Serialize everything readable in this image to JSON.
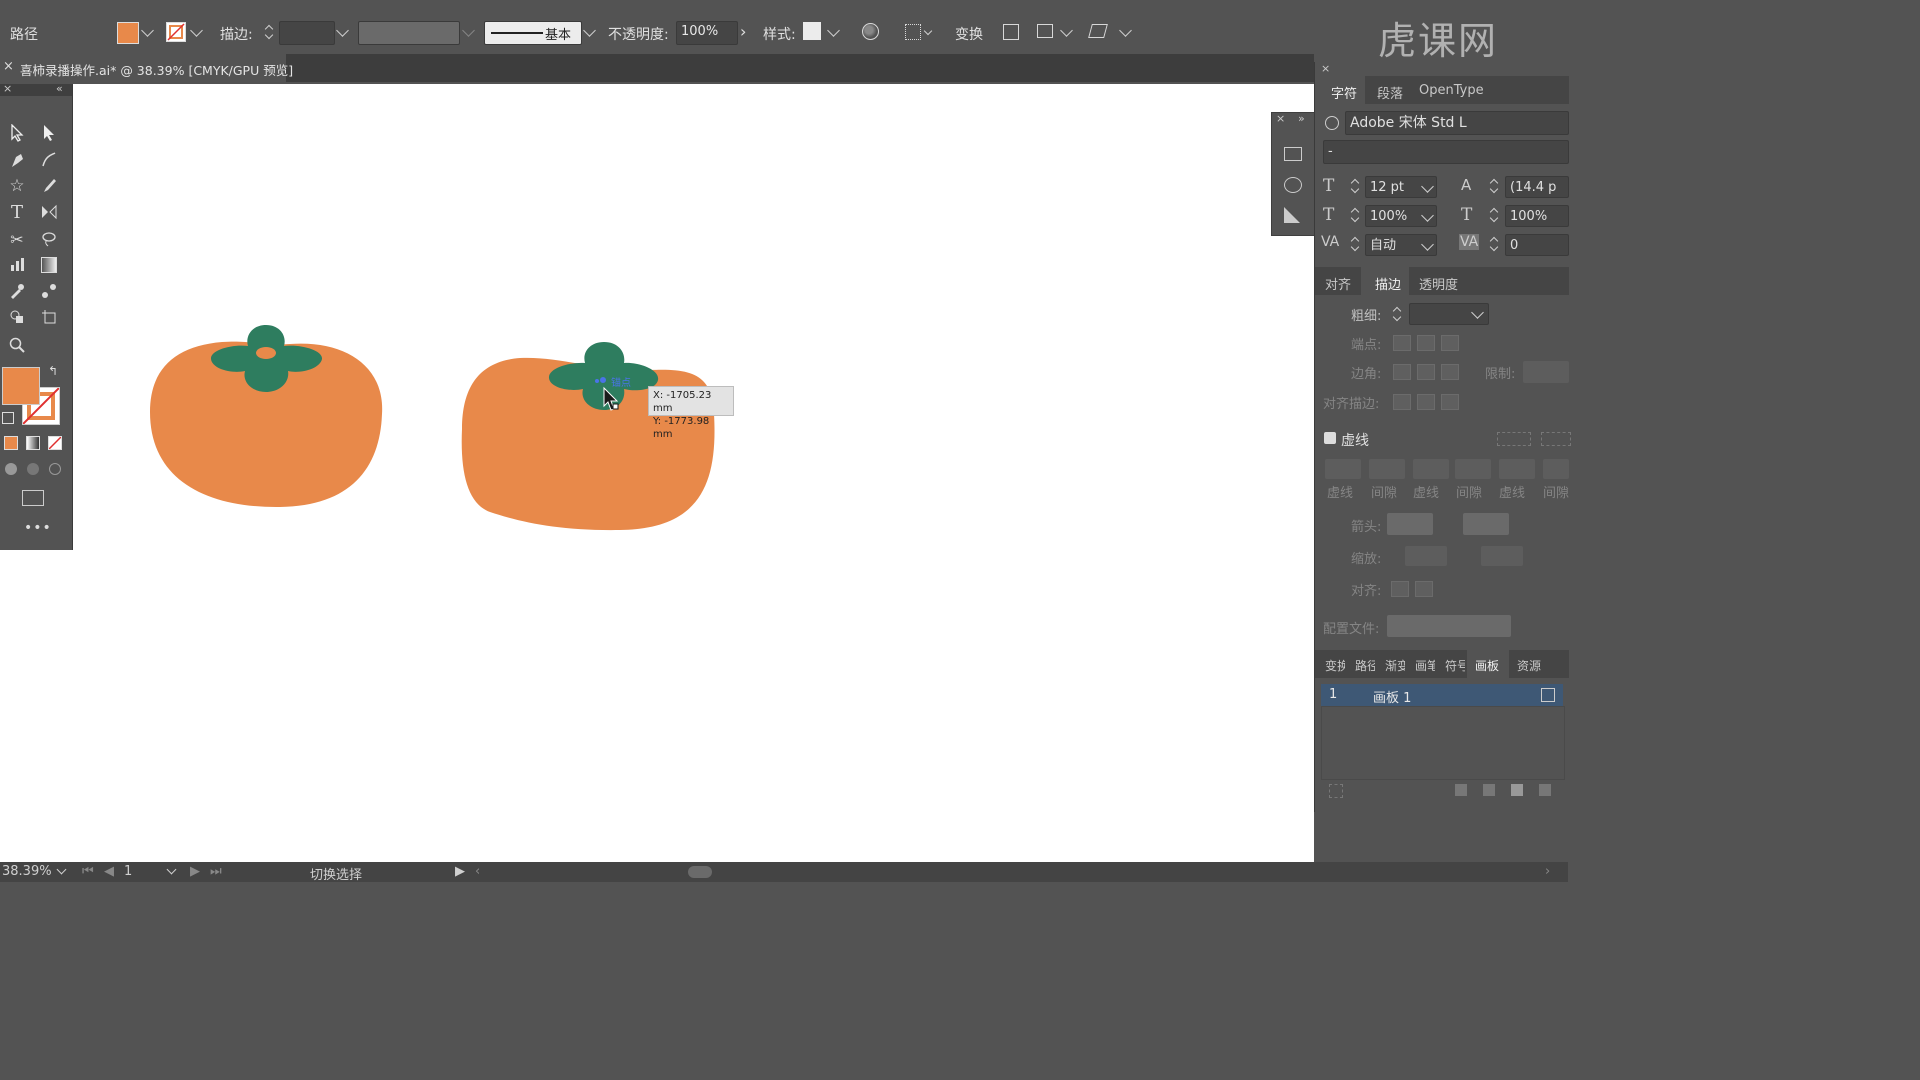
{
  "control_bar": {
    "object_type": "路径",
    "stroke_label": "描边:",
    "stroke_profile": "基本",
    "opacity_label": "不透明度:",
    "opacity_value": "100%",
    "style_label": "样式:",
    "transform_label": "变换",
    "fill_color": "#e8894a"
  },
  "document_tab": {
    "title": "喜柿录播操作.ai* @ 38.39% [CMYK/GPU 预览]"
  },
  "tooltip": {
    "x": "X: -1705.23 mm",
    "y": "Y: -1773.98 mm",
    "anchor_hint": "锚点"
  },
  "character_panel": {
    "tabs": [
      "字符",
      "段落",
      "OpenType"
    ],
    "font_family": "Adobe 宋体 Std L",
    "font_style": "-",
    "font_size": "12 pt",
    "leading": "(14.4 p",
    "vertical_scale": "100%",
    "horizontal_scale": "100%",
    "kerning": "自动",
    "tracking": "0"
  },
  "stroke_panel": {
    "tabs": [
      "对齐",
      "描边",
      "透明度"
    ],
    "weight_label": "粗细:",
    "cap_label": "端点:",
    "corner_label": "边角:",
    "limit_label": "限制:",
    "align_stroke_label": "对齐描边:",
    "dashed_label": "虚线",
    "dash_labels": [
      "虚线",
      "间隙",
      "虚线",
      "间隙",
      "虚线",
      "间隙"
    ],
    "arrow_label": "箭头:",
    "scale_label": "缩放:",
    "align_label": "对齐:",
    "profile_label": "配置文件:"
  },
  "artboard_panel": {
    "tabs": [
      "变换",
      "路径",
      "渐变",
      "画笔",
      "符号",
      "画板",
      "资源"
    ],
    "rows": [
      {
        "index": "1",
        "name": "画板 1"
      }
    ]
  },
  "status_bar": {
    "zoom": "38.39%",
    "page": "1",
    "mode": "切换选择"
  },
  "watermark": "虎课网",
  "colors": {
    "persimmon": "#e8894a",
    "leaf": "#2e7d5f",
    "selection": "#4a73e8"
  }
}
